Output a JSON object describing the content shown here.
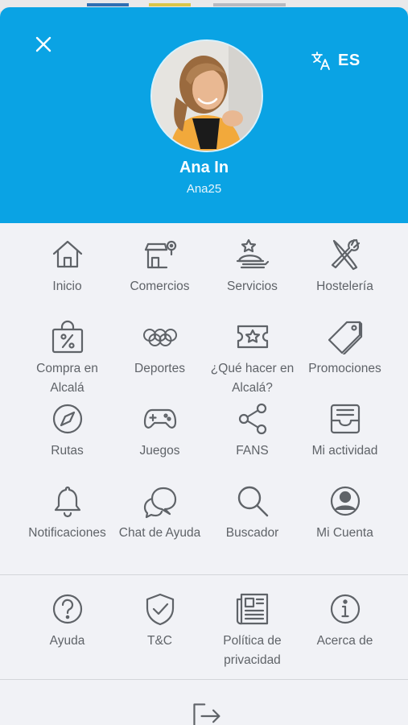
{
  "header": {
    "language_code": "ES",
    "user_name": "Ana In",
    "user_handle": "Ana25",
    "bg_color": "#0aa3e4"
  },
  "menu": {
    "items": [
      {
        "label": "Inicio",
        "icon": "home-icon"
      },
      {
        "label": "Comercios",
        "icon": "store-icon"
      },
      {
        "label": "Servicios",
        "icon": "service-icon"
      },
      {
        "label": "Hostelería",
        "icon": "fork-knife-icon"
      },
      {
        "label": "Compra en\nAlcalá",
        "icon": "shopping-bag-icon"
      },
      {
        "label": "Deportes",
        "icon": "olympic-rings-icon"
      },
      {
        "label": "¿Qué hacer en\nAlcalá?",
        "icon": "ticket-icon"
      },
      {
        "label": "Promociones",
        "icon": "tag-icon"
      },
      {
        "label": "Rutas",
        "icon": "compass-icon"
      },
      {
        "label": "Juegos",
        "icon": "gamepad-icon"
      },
      {
        "label": "FANS",
        "icon": "share-icon"
      },
      {
        "label": "Mi actividad",
        "icon": "inbox-icon"
      },
      {
        "label": "Notificaciones",
        "icon": "bell-icon"
      },
      {
        "label": "Chat de Ayuda",
        "icon": "chat-icon"
      },
      {
        "label": "Buscador",
        "icon": "search-icon"
      },
      {
        "label": "Mi Cuenta",
        "icon": "account-icon"
      }
    ]
  },
  "footer_menu": {
    "items": [
      {
        "label": "Ayuda",
        "icon": "help-icon"
      },
      {
        "label": "T&C",
        "icon": "shield-check-icon"
      },
      {
        "label": "Política de\nprivacidad",
        "icon": "newspaper-icon"
      },
      {
        "label": "Acerca de",
        "icon": "info-icon"
      }
    ]
  },
  "colors": {
    "accent": "#0aa3e4",
    "icon": "#5f6368",
    "background": "#f1f2f6"
  }
}
